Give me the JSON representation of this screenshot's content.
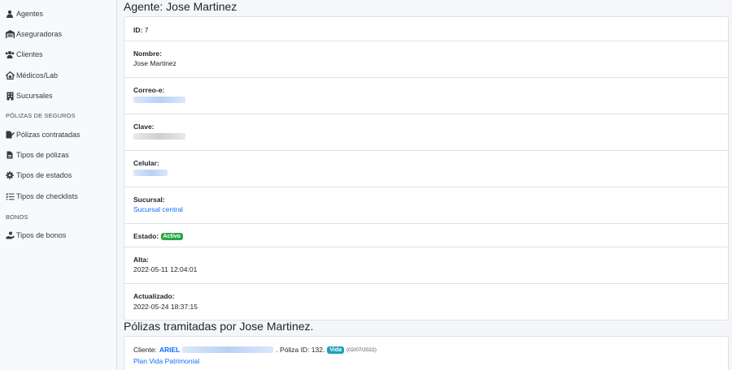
{
  "sidebar": {
    "items": [
      {
        "label": "Agentes",
        "icon": "user-tie-icon"
      },
      {
        "label": "Aseguradoras",
        "icon": "warehouse-icon"
      },
      {
        "label": "Clientes",
        "icon": "users-icon"
      },
      {
        "label": "Médicos/Lab",
        "icon": "clinic-icon"
      },
      {
        "label": "Sucursales",
        "icon": "building-icon"
      }
    ],
    "section1": "PÓLIZAS DE SEGUROS",
    "items2": [
      {
        "label": "Pólizas contratadas",
        "icon": "file-signature-icon"
      },
      {
        "label": "Tipos de pólizas",
        "icon": "file-icon"
      },
      {
        "label": "Tipos de estados",
        "icon": "gear-icon"
      },
      {
        "label": "Tipos de checklists",
        "icon": "list-check-icon"
      }
    ],
    "section2": "BONOS",
    "items3": [
      {
        "label": "Tipos de bonos",
        "icon": "hand-holding-dollar-icon"
      }
    ]
  },
  "page": {
    "title": "Agente: Jose Martinez",
    "section_title": "Pólizas tramitadas por Jose Martinez."
  },
  "agent": {
    "id_label": "ID:",
    "id_value": "7",
    "nombre_label": "Nombre:",
    "nombre_value": "Jose Martinez",
    "correo_label": "Correo-e:",
    "clave_label": "Clave:",
    "celular_label": "Celular:",
    "sucursal_label": "Sucursal:",
    "sucursal_value": "Sucursal central",
    "estado_label": "Estado:",
    "estado_value": "Activo",
    "alta_label": "Alta:",
    "alta_value": "2022-05-11 12:04:01",
    "actualizado_label": "Actualizado:",
    "actualizado_value": "2022-05-24 18:37:15"
  },
  "policy": {
    "cliente_label": "Cliente:",
    "cliente_name": "ARIEL",
    "poliza_label": ". Póliza ID: 132.",
    "tipo": "Vida",
    "fecha": "(02/07/2022)",
    "plan": "Plan Vida Patrimonial"
  },
  "colors": {
    "link": "#0d6efd",
    "badge_active": "#28a745",
    "badge_vida": "#17a2b8"
  }
}
